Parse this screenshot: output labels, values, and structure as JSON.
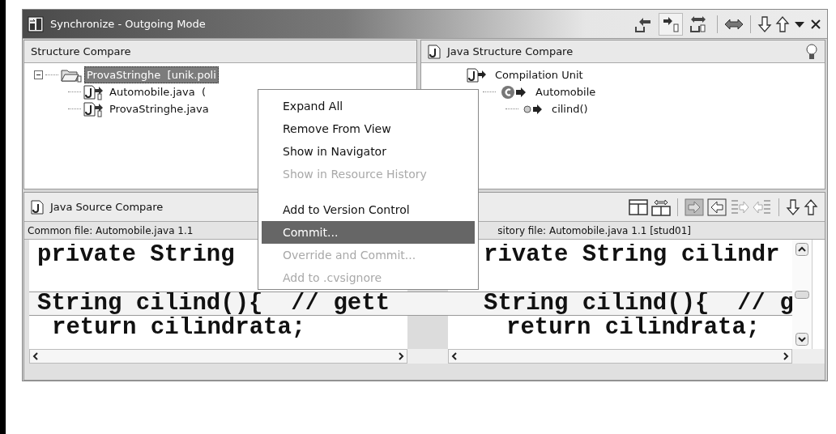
{
  "window": {
    "title": "Synchronize - Outgoing Mode"
  },
  "mode_buttons": [
    {
      "selected": false
    },
    {
      "selected": true
    },
    {
      "selected": false
    }
  ],
  "structure_compare": {
    "title": "Structure Compare",
    "tree": [
      {
        "label": "ProvaStringhe  [unik.poli",
        "selected": true,
        "expanded": true,
        "children": [
          {
            "label": "Automobile.java  (",
            "selected": false
          },
          {
            "label": "ProvaStringhe.java",
            "selected": false
          }
        ]
      }
    ]
  },
  "java_structure_compare": {
    "title": "Java Structure Compare",
    "tree": [
      {
        "label": "Compilation Unit",
        "kind": "unit",
        "children": [
          {
            "label": "Automobile",
            "kind": "class",
            "children": [
              {
                "label": "cilind()",
                "kind": "method"
              }
            ]
          }
        ]
      }
    ]
  },
  "source_compare": {
    "title": "Java Source Compare",
    "left_file": "Common file: Automobile.java 1.1",
    "right_file": "sitory file: Automobile.java 1.1 [stud01]",
    "rows": [
      {
        "kind": "code",
        "left": "private String",
        "right": "rivate String cilindr",
        "changed": false
      },
      {
        "kind": "blank"
      },
      {
        "kind": "code",
        "left": "String cilind(){  // gett",
        "right": "String cilind(){  // g",
        "changed": true
      },
      {
        "kind": "code",
        "left": "return cilindrata;",
        "right": "return cilindrata;",
        "changed": false
      }
    ]
  },
  "context_menu": [
    {
      "kind": "item",
      "label": "Expand All",
      "disabled": false,
      "selected": false
    },
    {
      "kind": "item",
      "label": "Remove From View",
      "disabled": false,
      "selected": false
    },
    {
      "kind": "item",
      "label": "Show in Navigator",
      "disabled": false,
      "selected": false
    },
    {
      "kind": "item",
      "label": "Show in Resource History",
      "disabled": true,
      "selected": false
    },
    {
      "kind": "separator"
    },
    {
      "kind": "item",
      "label": "Add to Version Control",
      "disabled": false,
      "selected": false
    },
    {
      "kind": "item",
      "label": "Commit...",
      "disabled": false,
      "selected": true
    },
    {
      "kind": "item",
      "label": "Override and Commit...",
      "disabled": true,
      "selected": false
    },
    {
      "kind": "item",
      "label": "Add to .cvsignore",
      "disabled": true,
      "selected": false
    }
  ]
}
